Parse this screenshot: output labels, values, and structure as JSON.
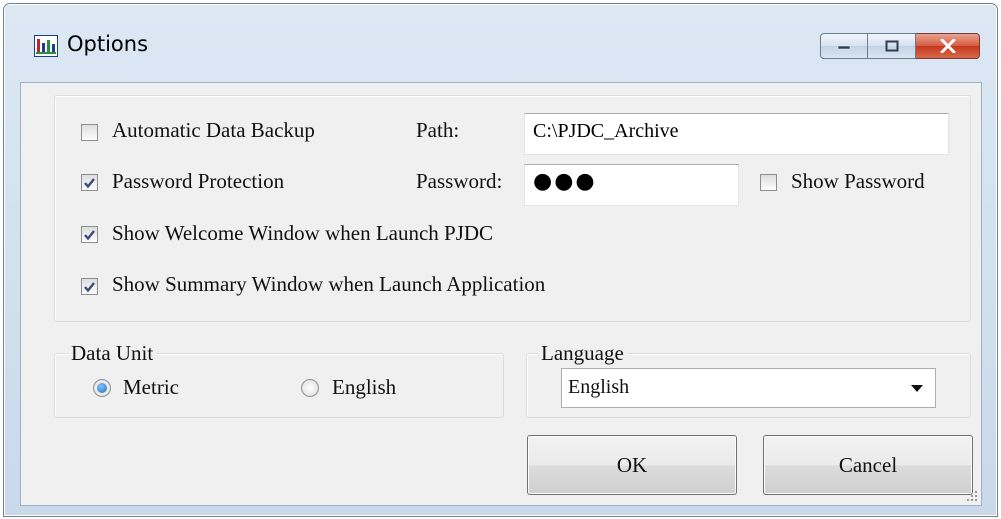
{
  "window": {
    "title": "Options",
    "app_icon": "bar-chart-icon"
  },
  "title_controls": [
    "minimize-icon",
    "maximize-icon",
    "close-icon"
  ],
  "options": {
    "auto_backup": {
      "label": "Automatic Data Backup",
      "checked": false
    },
    "path": {
      "label": "Path:",
      "value": "C:\\PJDC_Archive"
    },
    "password_protection": {
      "label": "Password Protection",
      "checked": true
    },
    "password": {
      "label": "Password:",
      "value": "●●●"
    },
    "show_password": {
      "label": "Show Password",
      "checked": false
    },
    "show_welcome": {
      "label": "Show Welcome Window when Launch PJDC",
      "checked": true
    },
    "show_summary": {
      "label": "Show Summary Window when Launch Application",
      "checked": true
    }
  },
  "data_unit": {
    "title": "Data Unit",
    "options": [
      {
        "label": "Metric",
        "selected": true
      },
      {
        "label": "English",
        "selected": false
      }
    ]
  },
  "language": {
    "title": "Language",
    "selected": "English"
  },
  "buttons": {
    "ok": "OK",
    "cancel": "Cancel"
  },
  "colors": {
    "title_bar": "#c9d9ea",
    "close_button": "#c5381e",
    "radio_selected": "#1f6fc2"
  }
}
